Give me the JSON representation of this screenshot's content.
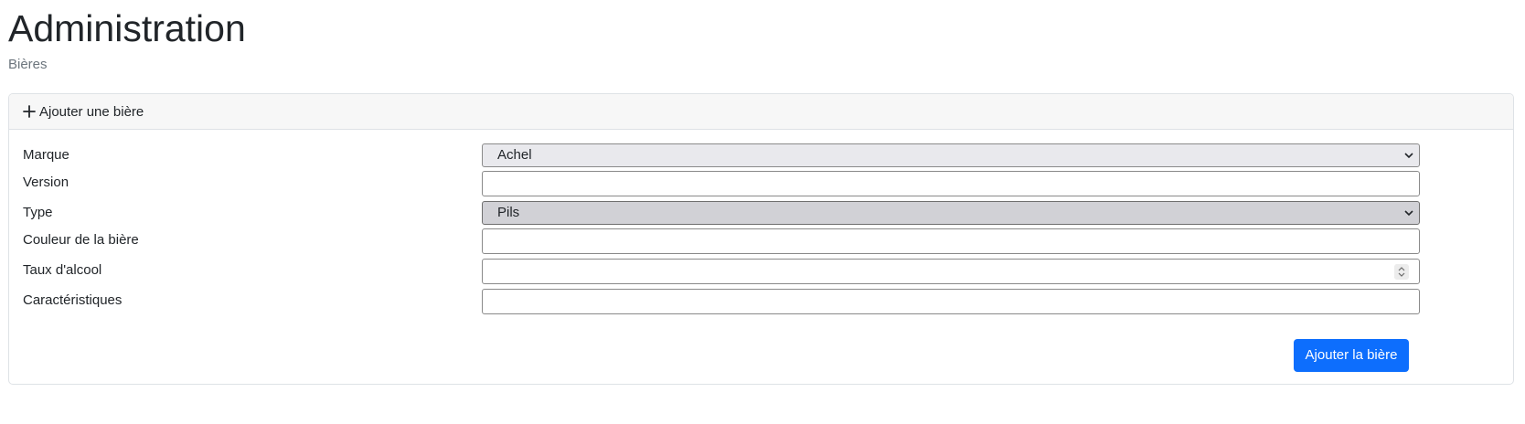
{
  "page": {
    "title": "Administration",
    "breadcrumb": "Bières"
  },
  "card": {
    "header_icon": "plus-icon",
    "header_label": "Ajouter une bière"
  },
  "form": {
    "marque": {
      "label": "Marque",
      "value": "Achel"
    },
    "version": {
      "label": "Version",
      "value": ""
    },
    "type": {
      "label": "Type",
      "value": "Pils"
    },
    "couleur": {
      "label": "Couleur de la bière",
      "value": ""
    },
    "alcool": {
      "label": "Taux d'alcool",
      "value": ""
    },
    "caracteristiques": {
      "label": "Caractéristiques",
      "value": ""
    }
  },
  "actions": {
    "submit_label": "Ajouter la bière"
  },
  "colors": {
    "primary": "#0d6efd",
    "header_bg": "#f7f7f7",
    "muted_text": "#6c757d"
  }
}
